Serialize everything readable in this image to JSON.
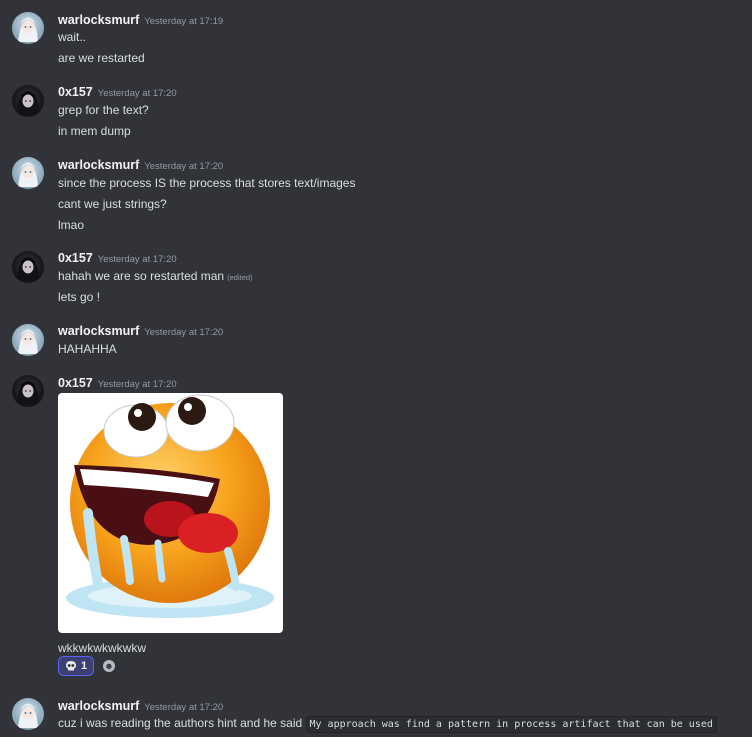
{
  "messages": [
    {
      "author": "warlocksmurf",
      "timestamp": "Yesterday at 17:19",
      "lines": [
        "wait..",
        "are we restarted"
      ]
    },
    {
      "author": "0x157",
      "timestamp": "Yesterday at 17:20",
      "lines": [
        "grep for the text?",
        "in mem dump"
      ]
    },
    {
      "author": "warlocksmurf",
      "timestamp": "Yesterday at 17:20",
      "lines": [
        "since the process IS the process that stores text/images",
        "cant we just strings?",
        "lmao"
      ]
    },
    {
      "author": "0x157",
      "timestamp": "Yesterday at 17:20",
      "lines": [
        "hahah we are so restarted man",
        "lets go !"
      ],
      "edited_label": "(edited)"
    },
    {
      "author": "warlocksmurf",
      "timestamp": "Yesterday at 17:20",
      "lines": [
        "HAHAHHA"
      ]
    },
    {
      "author": "0x157",
      "timestamp": "Yesterday at 17:20",
      "lines": [
        "wkkwkwkwkwkw"
      ],
      "attachment_icon": "melting-laughing-emoji-gif",
      "reaction": {
        "emoji_icon": "skull-icon",
        "count": "1"
      }
    },
    {
      "author": "warlocksmurf",
      "timestamp": "Yesterday at 17:20",
      "lines": [
        "cuz i was reading the authors hint and he said"
      ],
      "inline_code": "My approach was find a pattern in process artifact that can be used"
    }
  ],
  "colors": {
    "background": "#313338",
    "text": "#dbdee1",
    "author": "#f2f3f5",
    "timestamp": "#949ba4",
    "reaction_accent": "#5865f2"
  }
}
